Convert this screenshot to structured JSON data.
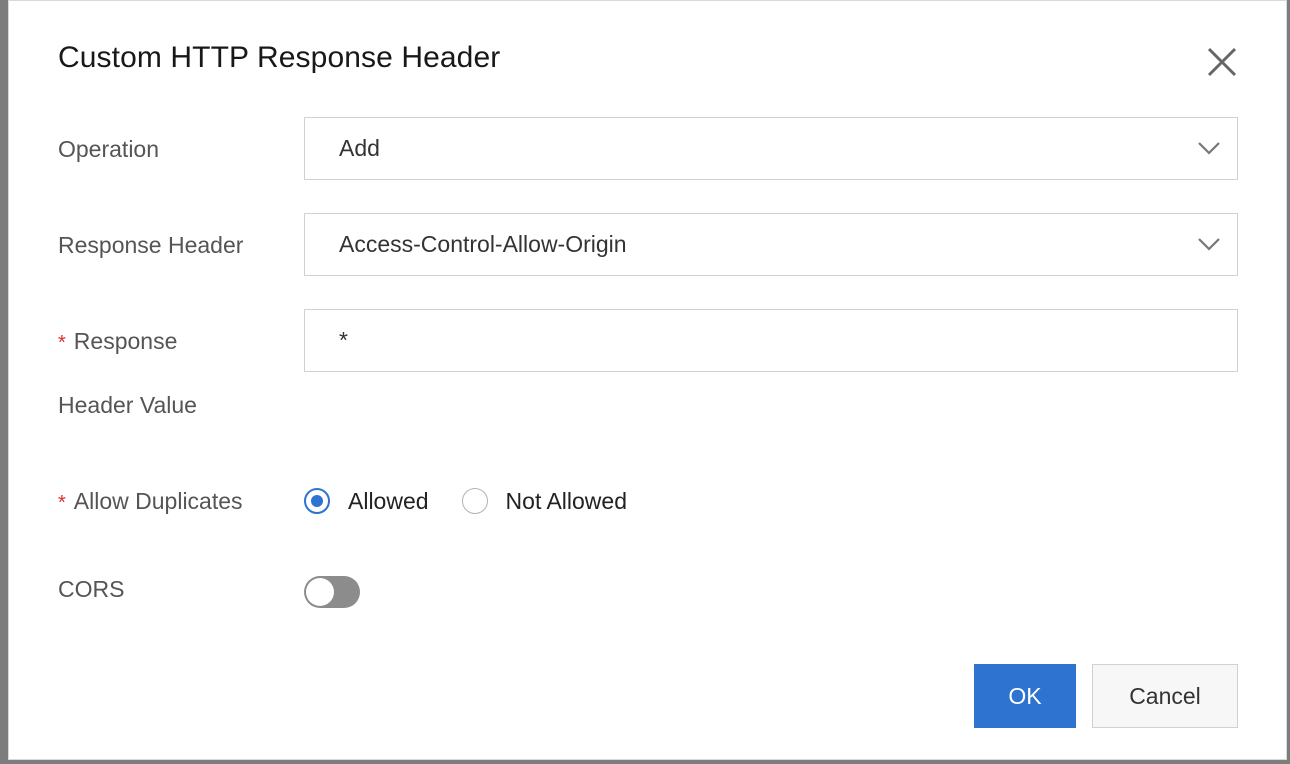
{
  "dialog": {
    "title": "Custom HTTP Response Header"
  },
  "form": {
    "operation": {
      "label": "Operation",
      "value": "Add"
    },
    "response_header": {
      "label": "Response Header",
      "value": "Access-Control-Allow-Origin"
    },
    "response_header_value": {
      "required_mark": "*",
      "label_line1": "Response",
      "label_line2": "Header Value",
      "value": "*"
    },
    "allow_duplicates": {
      "required_mark": "*",
      "label": "Allow Duplicates",
      "options": [
        {
          "label": "Allowed",
          "checked": true
        },
        {
          "label": "Not Allowed",
          "checked": false
        }
      ]
    },
    "cors": {
      "label": "CORS",
      "enabled": false
    }
  },
  "buttons": {
    "ok_label": "OK",
    "cancel_label": "Cancel"
  },
  "colors": {
    "primary": "#2f73d1",
    "required": "#d93026",
    "toggle_off": "#8c8c8c"
  },
  "icons": {
    "close": "close-icon",
    "dropdown": "chevron-down-icon"
  }
}
